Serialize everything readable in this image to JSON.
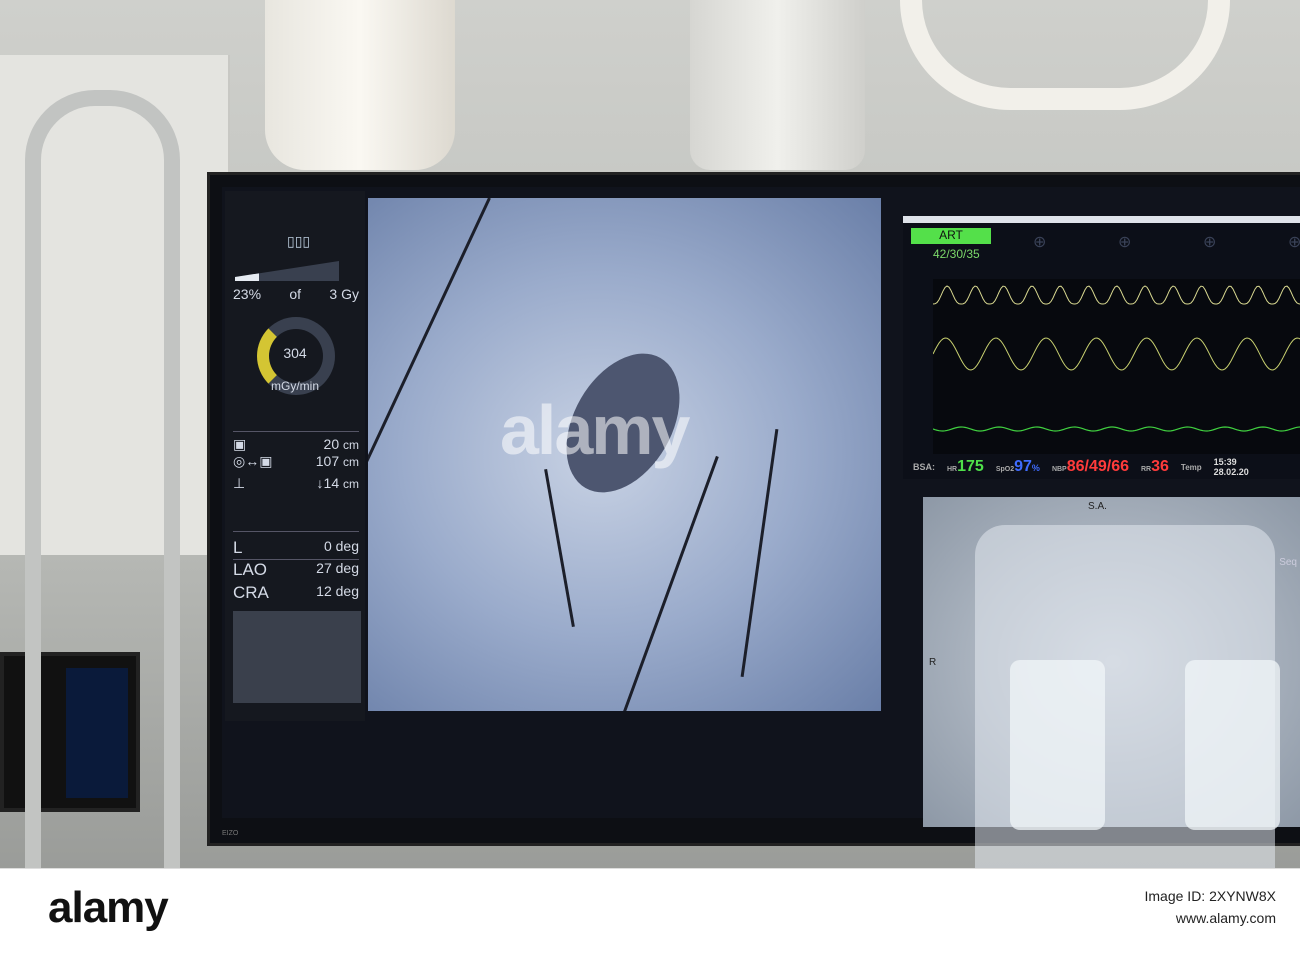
{
  "dose_panel": {
    "percent": "23%",
    "of": "of",
    "total": "3 Gy",
    "dose_rate": "304",
    "dose_rate_unit": "mGy/min",
    "dose_fraction": 0.23,
    "distances": [
      {
        "value": "20",
        "unit": "cm"
      },
      {
        "value": "107",
        "unit": "cm"
      },
      {
        "value": "↓14",
        "unit": "cm"
      }
    ],
    "angles": [
      {
        "label": "L",
        "value": "0",
        "unit": "deg"
      },
      {
        "label": "LAO",
        "value": "27",
        "unit": "deg"
      },
      {
        "label": "CRA",
        "value": "12",
        "unit": "deg"
      }
    ]
  },
  "vitals": {
    "art_label": "ART",
    "art_value": "42/30/35",
    "hr_label": "HR",
    "hr": "175",
    "spo2_label": "SpO2",
    "spo2": "97",
    "spo2_unit": "%",
    "nbp_label": "NBP",
    "nbp": "86/49/66",
    "rr_label": "RR",
    "rr": "36",
    "bsa": "BSA:",
    "temp_label": "Temp",
    "time": "15:39",
    "date": "28.02.20",
    "colors": {
      "hr": "#4fe04a",
      "spo2": "#3f6cff",
      "nbp": "#ff3b3b",
      "rr": "#ff3b3b"
    }
  },
  "angio": {
    "label_sa": "S.A.",
    "label_r": "R",
    "label_seq": "Seq"
  },
  "monitor_brand": "EIZO",
  "watermark": "alamy",
  "footer": {
    "logo": "alamy",
    "image_id_label": "Image ID: 2XYNW8X",
    "url": "www.alamy.com"
  }
}
